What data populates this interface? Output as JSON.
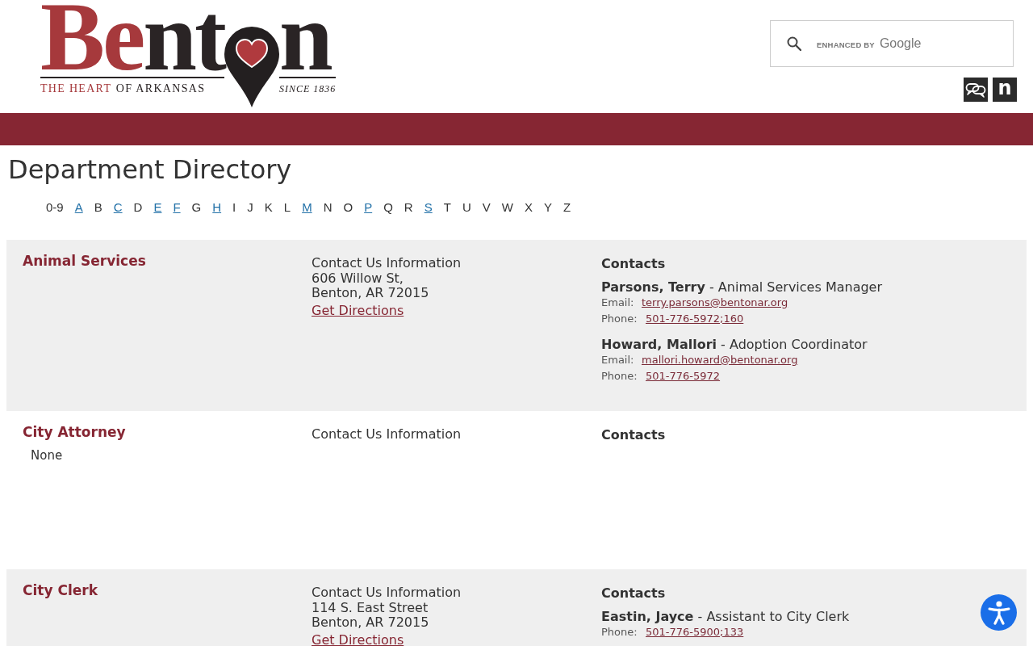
{
  "header": {
    "logo": {
      "wordmark_red": "Be",
      "wordmark_dark": "nt",
      "wordmark_end": "n",
      "tagline_red": "THE HEART",
      "tagline_dark": "OF ARKANSAS",
      "since": "SINCE 1836"
    },
    "search": {
      "branding_label": "ENHANCED BY",
      "branding_name": "Google"
    },
    "social_links": [
      {
        "kind": "chat"
      },
      {
        "kind": "letter",
        "text": "n"
      }
    ]
  },
  "page_title": "Department Directory",
  "alphabet": [
    {
      "label": "0-9",
      "linked": false
    },
    {
      "label": "A",
      "linked": true
    },
    {
      "label": "B",
      "linked": false
    },
    {
      "label": "C",
      "linked": true
    },
    {
      "label": "D",
      "linked": false
    },
    {
      "label": "E",
      "linked": true
    },
    {
      "label": "F",
      "linked": true
    },
    {
      "label": "G",
      "linked": false
    },
    {
      "label": "H",
      "linked": true
    },
    {
      "label": "I",
      "linked": false
    },
    {
      "label": "J",
      "linked": false
    },
    {
      "label": "K",
      "linked": false
    },
    {
      "label": "L",
      "linked": false
    },
    {
      "label": "M",
      "linked": true
    },
    {
      "label": "N",
      "linked": false
    },
    {
      "label": "O",
      "linked": false
    },
    {
      "label": "P",
      "linked": true
    },
    {
      "label": "Q",
      "linked": false
    },
    {
      "label": "R",
      "linked": false
    },
    {
      "label": "S",
      "linked": true
    },
    {
      "label": "T",
      "linked": false
    },
    {
      "label": "U",
      "linked": false
    },
    {
      "label": "V",
      "linked": false
    },
    {
      "label": "W",
      "linked": false
    },
    {
      "label": "X",
      "linked": false
    },
    {
      "label": "Y",
      "linked": false
    },
    {
      "label": "Z",
      "linked": false
    }
  ],
  "departments": [
    {
      "name": "Animal Services",
      "contact_info": {
        "heading": "Contact Us Information",
        "address_lines": [
          "606 Willow St,",
          "Benton, AR 72015"
        ],
        "directions_link": "Get Directions"
      },
      "contacts_heading": "Contacts",
      "contacts": [
        {
          "line": "**Parsons, Terry** - Animal Services Manager",
          "details": [
            {
              "kind": "email",
              "label": "Email:",
              "value": "terry.parsons@bentonar.org"
            },
            {
              "kind": "phone",
              "label": "Phone:",
              "value": "501-776-5972;160"
            }
          ]
        },
        {
          "line": "**Howard, Mallori** - Adoption Coordinator",
          "details": [
            {
              "kind": "email",
              "label": "Email:",
              "value": "mallori.howard@bentonar.org"
            },
            {
              "kind": "phone",
              "label": "Phone:",
              "value": "501-776-5972"
            }
          ]
        }
      ]
    },
    {
      "name": "City Attorney",
      "description": "None",
      "contact_info": {
        "heading": "Contact Us Information"
      },
      "contacts_heading": "Contacts"
    },
    {
      "name": "City Clerk",
      "contact_info": {
        "heading": "Contact Us Information",
        "address_lines": [
          "114 S. East Street",
          "Benton, AR 72015"
        ],
        "directions_link": "Get Directions"
      },
      "contacts_heading": "Contacts",
      "contacts": [
        {
          "line": "**Eastin, Jayce** - Assistant to City Clerk",
          "details": [
            {
              "kind": "phone",
              "label": "Phone:",
              "value": "501-776-5900;133"
            }
          ]
        }
      ]
    }
  ]
}
